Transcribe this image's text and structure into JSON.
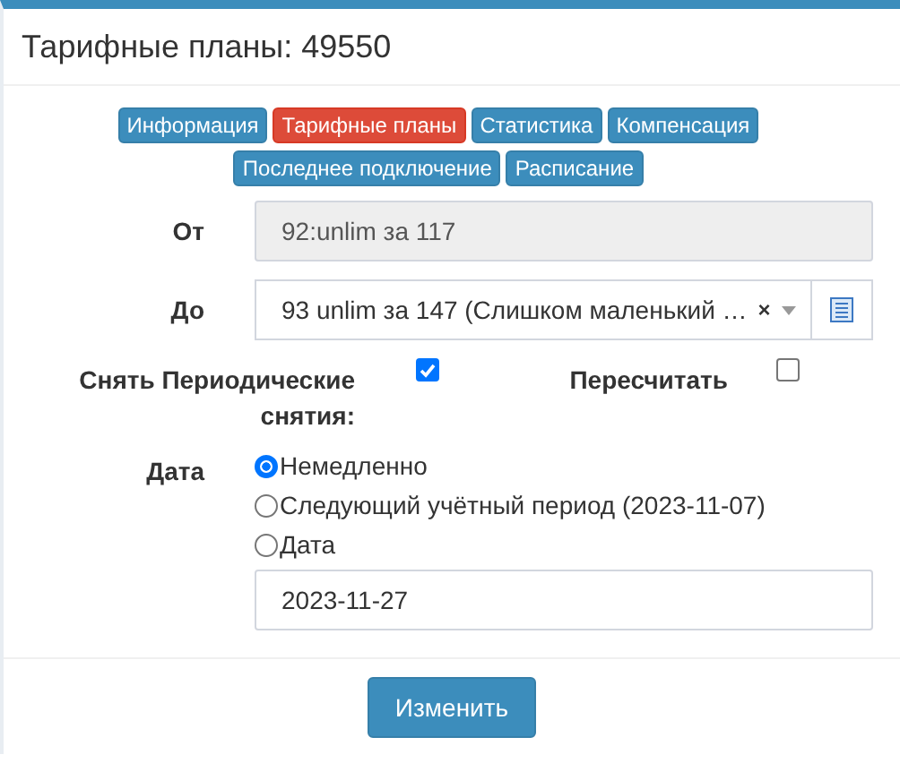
{
  "title": "Тарифные планы: 49550",
  "tabs": [
    {
      "label": "Информация",
      "selected": false
    },
    {
      "label": "Тарифные планы",
      "selected": true
    },
    {
      "label": "Статистика",
      "selected": false
    },
    {
      "label": "Компенсация",
      "selected": false
    },
    {
      "label": "Последнее подключение",
      "selected": false
    },
    {
      "label": "Расписание",
      "selected": false
    }
  ],
  "from": {
    "label": "От",
    "value": "92:unlim за 117",
    "disabled": true
  },
  "to": {
    "label": "До",
    "value": "93 unlim за 147 (Слишком маленький …",
    "clear": "×"
  },
  "checks": [
    {
      "label": "Снять Периодические снятия:",
      "checked": true
    },
    {
      "label": "Пересчитать",
      "checked": false
    }
  ],
  "date": {
    "label": "Дата",
    "options": [
      {
        "label": "Немедленно",
        "selected": true
      },
      {
        "label": "Следующий учётный период (2023-11-07)",
        "selected": false
      },
      {
        "label": "Дата",
        "selected": false
      }
    ],
    "value": "2023-11-27"
  },
  "submit": "Изменить"
}
